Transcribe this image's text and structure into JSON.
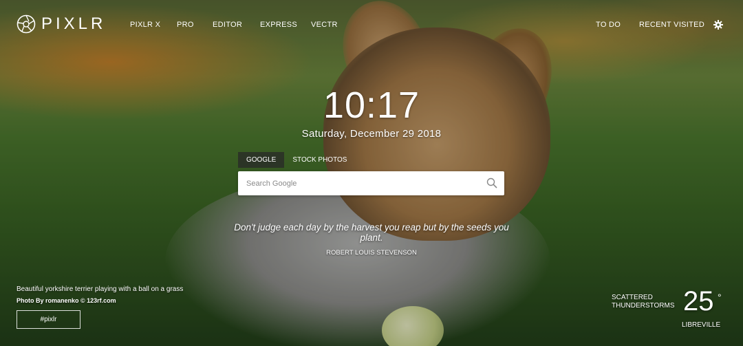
{
  "brand": {
    "logo_text": "PIXLR"
  },
  "nav_left": [
    {
      "label": "PIXLR X"
    },
    {
      "label": "PRO"
    },
    {
      "label": "EDITOR"
    },
    {
      "label": "EXPRESS"
    },
    {
      "label": "VECTR"
    }
  ],
  "nav_right": [
    {
      "label": "TO DO"
    },
    {
      "label": "RECENT VISITED"
    }
  ],
  "clock": {
    "time": "10:17",
    "date": "Saturday, December 29 2018"
  },
  "search": {
    "tabs": [
      {
        "label": "GOOGLE",
        "active": true
      },
      {
        "label": "STOCK PHOTOS",
        "active": false
      }
    ],
    "placeholder": "Search Google"
  },
  "quote": {
    "text": "Don't judge each day by the harvest you reap but by the seeds you plant.",
    "author": "ROBERT LOUIS STEVENSON"
  },
  "credit": {
    "title": "Beautiful yorkshire terrier playing with a ball on a grass",
    "photo_by": "Photo By romanenko © 123rf.com",
    "tag_button": "#pixlr"
  },
  "weather": {
    "condition_line1": "SCATTERED",
    "condition_line2": "THUNDERSTORMS",
    "temperature": "25",
    "degree_symbol": "°",
    "city": "LIBREVILLE"
  },
  "colors": {
    "text": "#ffffff",
    "active_tab_bg": "#2a2a2a",
    "search_bg": "#ffffff"
  }
}
